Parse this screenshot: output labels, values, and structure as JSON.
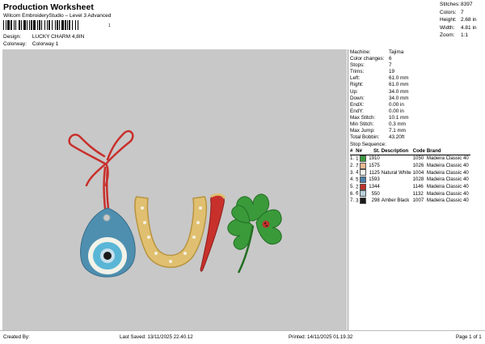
{
  "header": {
    "title": "Production Worksheet",
    "subtitle": "Wilcom EmbroideryStudio – Level 3 Advanced",
    "barcode_number": "1"
  },
  "design_info": {
    "design_label": "Design:",
    "design_value": "LUCKY CHARM 4,8IN",
    "colorway_label": "Colorway:",
    "colorway_value": "Colorway 1"
  },
  "stats": [
    {
      "label": "Stitches:",
      "value": "8397"
    },
    {
      "label": "Colors:",
      "value": "7"
    },
    {
      "label": "Height:",
      "value": "2.68 in"
    },
    {
      "label": "Width:",
      "value": "4.81 in"
    },
    {
      "label": "Zoom:",
      "value": "1:1"
    }
  ],
  "properties": [
    {
      "label": "Machine:",
      "value": "Tajima"
    },
    {
      "label": "Color changes:",
      "value": "6"
    },
    {
      "label": "Stops:",
      "value": "7"
    },
    {
      "label": "Trims:",
      "value": "19"
    },
    {
      "label": "Left:",
      "value": "61.0 mm"
    },
    {
      "label": "Right:",
      "value": "61.0 mm"
    },
    {
      "label": "Up:",
      "value": "34.0 mm"
    },
    {
      "label": "Down:",
      "value": "34.0 mm"
    },
    {
      "label": "EndX:",
      "value": "0.00 in"
    },
    {
      "label": "EndY:",
      "value": "0.00 in"
    },
    {
      "label": "Max Stitch:",
      "value": "10.1 mm"
    },
    {
      "label": "Min Stitch:",
      "value": "0.3 mm"
    },
    {
      "label": "Max Jump:",
      "value": "7.1 mm"
    },
    {
      "label": "Total Bobbin:",
      "value": "43.20ft"
    }
  ],
  "stop_sequence": {
    "heading": "Stop Sequence:",
    "columns": [
      "#",
      "N#",
      "St.",
      "Description",
      "Code",
      "Brand"
    ],
    "rows": [
      {
        "num": "1.",
        "n": "1",
        "color": "#3a9a3a",
        "st": "1910",
        "desc": "",
        "code": "1050",
        "brand": "Madeira Classic 40"
      },
      {
        "num": "2.",
        "n": "7",
        "color": "#f0b890",
        "st": "1575",
        "desc": "",
        "code": "1026",
        "brand": "Madeira Classic 40"
      },
      {
        "num": "3.",
        "n": "4",
        "color": "#f4f4ee",
        "st": "1125",
        "desc": "Natural White",
        "code": "1004",
        "brand": "Madeira Classic 40"
      },
      {
        "num": "4.",
        "n": "5",
        "color": "#4a7fa8",
        "st": "1593",
        "desc": "",
        "code": "1028",
        "brand": "Madeira Classic 40"
      },
      {
        "num": "5.",
        "n": "2",
        "color": "#c0302a",
        "st": "1344",
        "desc": "",
        "code": "1146",
        "brand": "Madeira Classic 40"
      },
      {
        "num": "6.",
        "n": "6",
        "color": "#b8d0dc",
        "st": "550",
        "desc": "",
        "code": "1132",
        "brand": "Madeira Classic 40"
      },
      {
        "num": "7.",
        "n": "3",
        "color": "#1a1a1a",
        "st": "298",
        "desc": "Amber Black",
        "code": "1007",
        "brand": "Madeira Classic 40"
      }
    ]
  },
  "footer": {
    "created_by": "Created By:",
    "last_saved": "Last Saved: 13/11/2025 22.40.12",
    "printed": "Printed: 14/11/2025 01.19.32",
    "page": "Page 1 of 1"
  }
}
